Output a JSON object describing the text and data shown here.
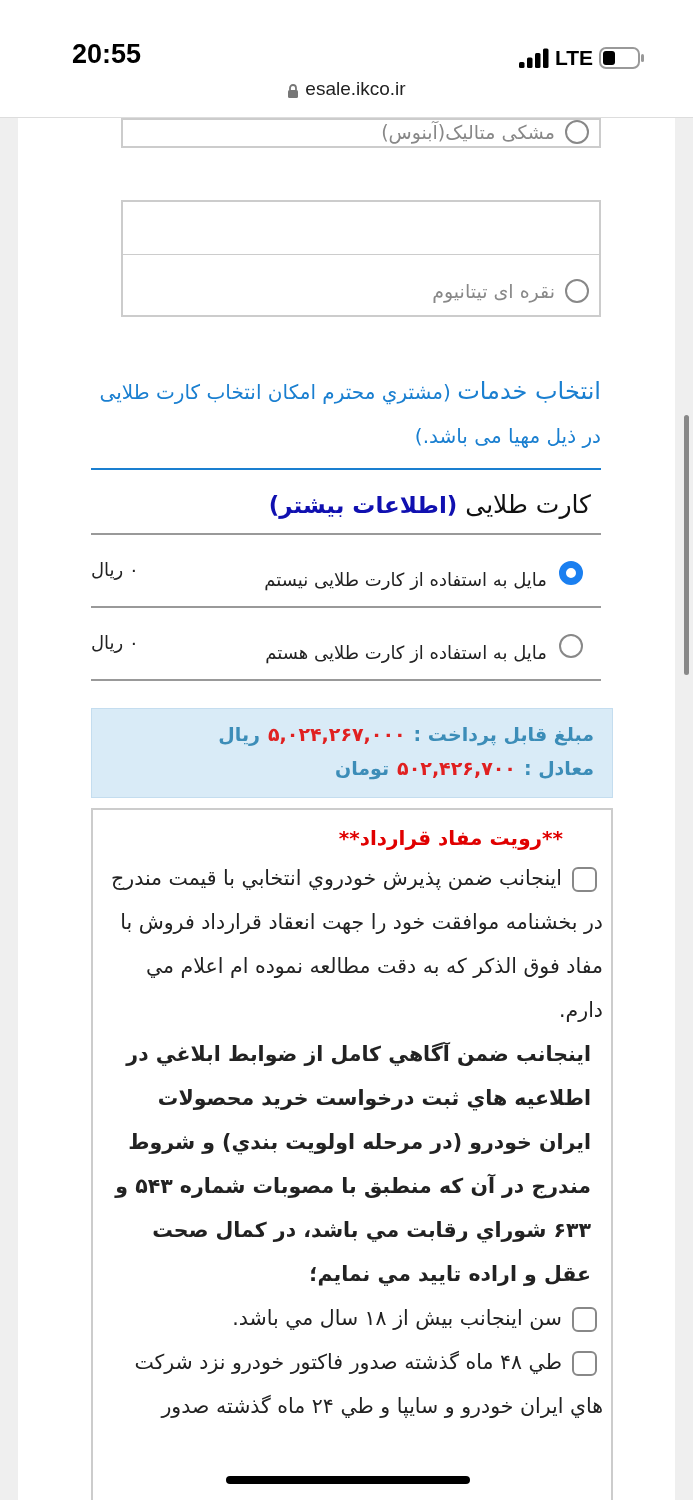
{
  "status_bar": {
    "time": "20:55",
    "network": "LTE"
  },
  "address_bar": {
    "url": "esale.ikco.ir"
  },
  "color_options": [
    {
      "label": "مشکی متالیک(آبنوس)",
      "selected": false
    },
    {
      "label": "نقره ای تیتانیوم",
      "selected": false
    }
  ],
  "services": {
    "title": "انتخاب خدمات",
    "note": "(مشتري محترم امکان انتخاب کارت طلایی در ذیل مهیا می باشد.)"
  },
  "gold_card": {
    "title": "کارت طلایی",
    "link": "(اطلاعات بیشتر)",
    "options": [
      {
        "label": "مایل به استفاده از کارت طلایی نیستم",
        "price": "۰ ریال",
        "selected": true
      },
      {
        "label": "مایل به استفاده از کارت طلایی هستم",
        "price": "۰ ریال",
        "selected": false
      }
    ]
  },
  "payment": [
    {
      "label": "مبلغ قابل پرداخت :",
      "amount": "۵,۰۲۴,۲۶۷,۰۰۰",
      "unit": "ریال"
    },
    {
      "label": "معادل :",
      "amount": "۵۰۲,۴۲۶,۷۰۰",
      "unit": "تومان"
    }
  ],
  "contract": {
    "title": "**رویت مفاد قرارداد**",
    "items": [
      {
        "kind": "checkbox",
        "checked": false,
        "text": "اينجانب ضمن پذيرش خودروي انتخابي با قيمت مندرج در بخشنامه موافقت خود را جهت انعقاد قرارداد فروش با مفاد فوق الذكر كه به دقت مطالعه نموده ام اعلام مي دارم."
      },
      {
        "kind": "statement",
        "text": "اينجانب ضمن آگاهي كامل از ضوابط ابلاغي در اطلاعيه هاي ثبت درخواست خريد محصولات ايران خودرو (در مرحله اولويت بندي) و شروط مندرج در آن كه منطبق با مصوبات شماره ۵۴۳ و ۶۳۳ شوراي رقابت مي باشد، در كمال صحت عقل و اراده تاييد مي نمايم؛"
      },
      {
        "kind": "checkbox",
        "checked": false,
        "text": "سن اينجانب بيش از ۱۸ سال مي باشد."
      },
      {
        "kind": "checkbox",
        "checked": false,
        "text": "طي ۴۸ ماه گذشته صدور فاكتور خودرو نزد شركت هاي ايران خودرو و سايپا و طي ۲۴ ماه گذشته صدور"
      }
    ]
  }
}
